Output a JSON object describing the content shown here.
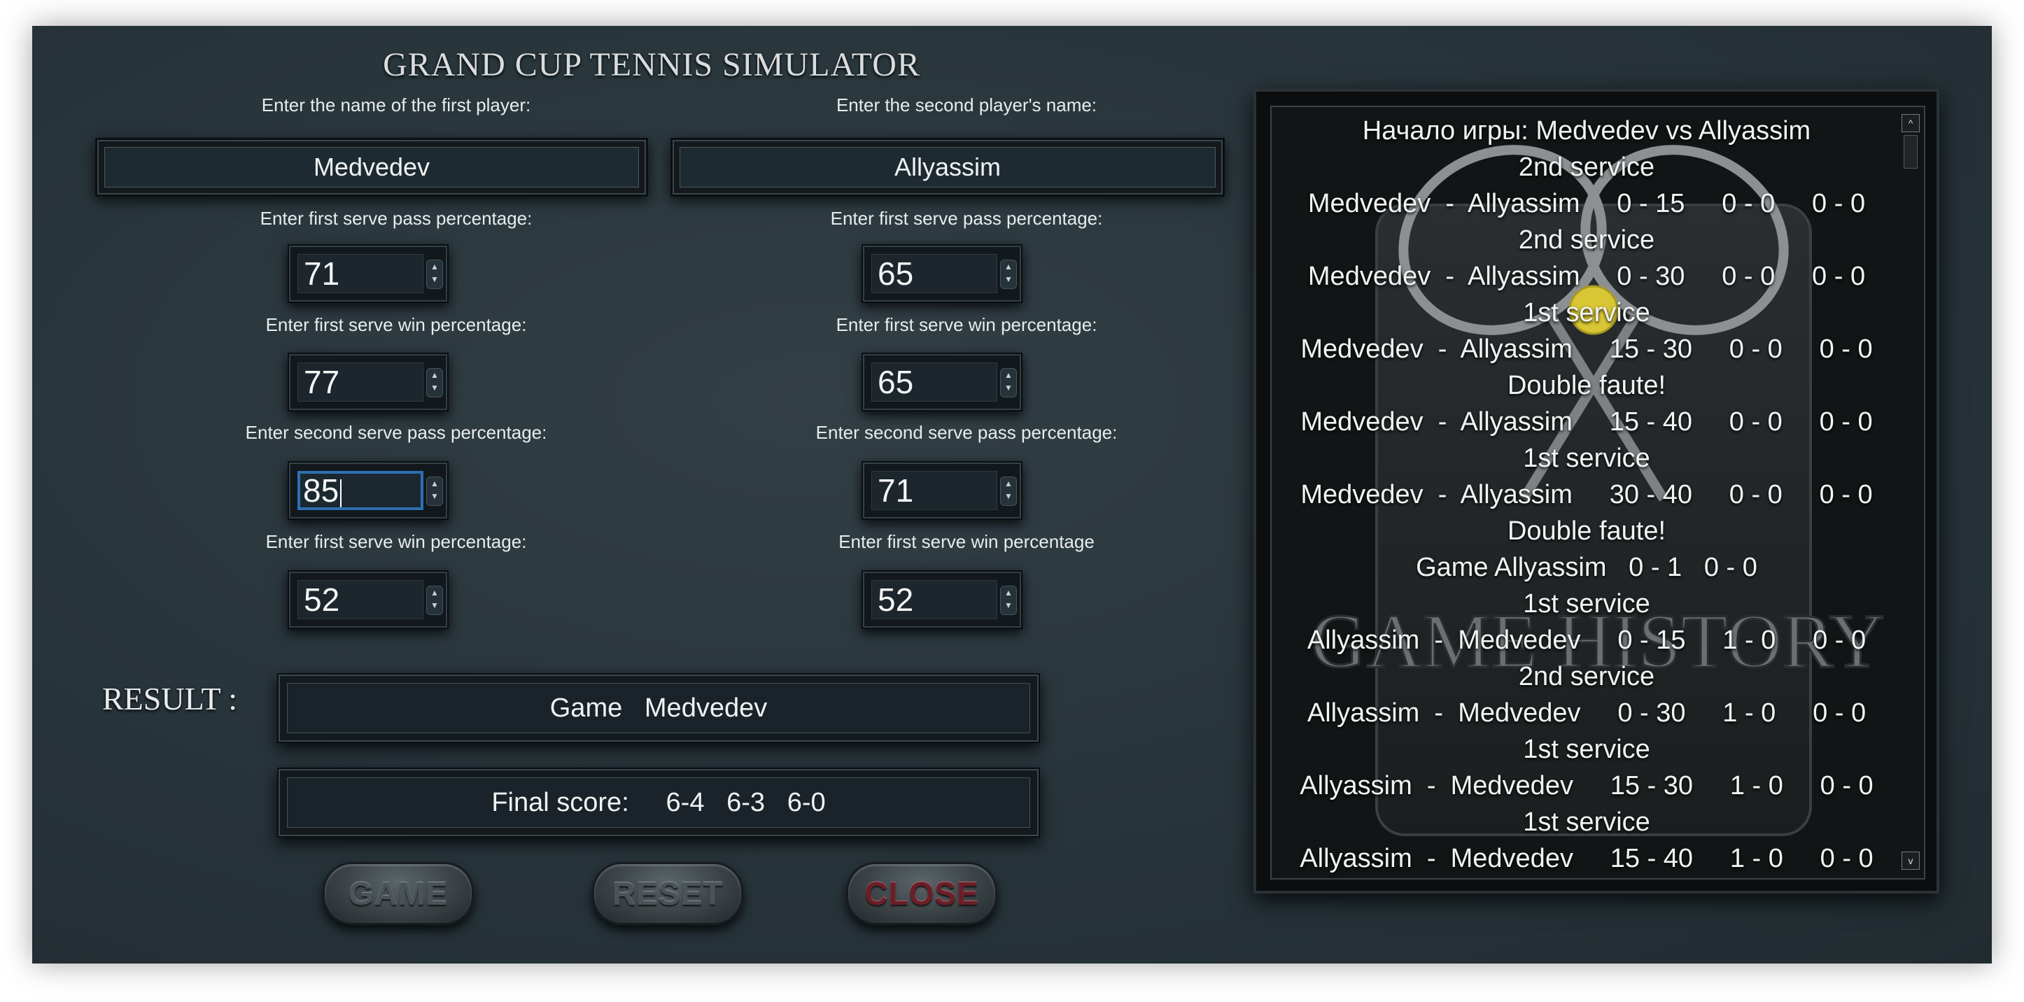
{
  "app": {
    "title": "GRAND CUP TENNIS SIMULATOR"
  },
  "player1": {
    "name_label": "Enter the name of the first player:",
    "name": "Medvedev",
    "fields": [
      {
        "label": "Enter first serve pass percentage:",
        "value": "71"
      },
      {
        "label": "Enter first serve win percentage:",
        "value": "77"
      },
      {
        "label": "Enter second serve pass percentage:",
        "value": "85"
      },
      {
        "label": "Enter first serve win percentage:",
        "value": "52"
      }
    ]
  },
  "player2": {
    "name_label": "Enter the second player's name:",
    "name": "Allyassim",
    "fields": [
      {
        "label": "Enter first serve pass percentage:",
        "value": "65"
      },
      {
        "label": "Enter first serve win percentage:",
        "value": "65"
      },
      {
        "label": "Enter second serve pass percentage:",
        "value": "71"
      },
      {
        "label": "Enter first serve win percentage",
        "value": "52"
      }
    ]
  },
  "result": {
    "label": "RESULT :",
    "game_text": "Game   Medvedev",
    "final_score_text": "Final score:     6-4   6-3   6-0"
  },
  "buttons": {
    "game": "GAME",
    "reset": "RESET",
    "close": "CLOSE"
  },
  "history": {
    "background_text": "GAME HISTORY",
    "lines": [
      "Начало игры: Medvedev vs Allyassim",
      "2nd service",
      "Medvedev  -  Allyassim     0 - 15     0 - 0     0 - 0",
      "2nd service",
      "Medvedev  -  Allyassim     0 - 30     0 - 0     0 - 0",
      "1st service",
      "Medvedev  -  Allyassim     15 - 30     0 - 0     0 - 0",
      "Double faute!",
      "Medvedev  -  Allyassim     15 - 40     0 - 0     0 - 0",
      "1st service",
      "Medvedev  -  Allyassim     30 - 40     0 - 0     0 - 0",
      "Double faute!",
      "Game Allyassim   0 - 1   0 - 0",
      "1st service",
      "Allyassim  -  Medvedev     0 - 15     1 - 0     0 - 0",
      "2nd service",
      "Allyassim  -  Medvedev     0 - 30     1 - 0     0 - 0",
      "1st service",
      "Allyassim  -  Medvedev     15 - 30     1 - 0     0 - 0",
      "1st service",
      "Allyassim  -  Medvedev     15 - 40     1 - 0     0 - 0"
    ]
  },
  "icons": {
    "spin": "spin-arrows-icon",
    "scroll_up": "scroll-up-icon",
    "scroll_down": "scroll-down-icon"
  }
}
